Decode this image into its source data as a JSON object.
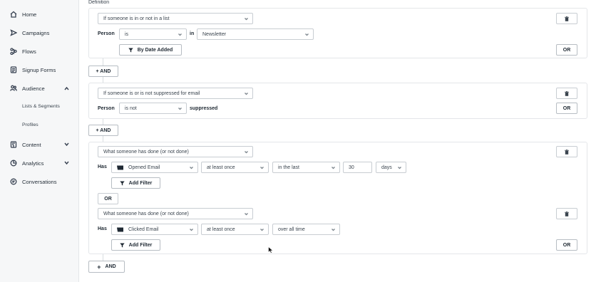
{
  "sidebar": {
    "items": [
      {
        "label": "Home",
        "icon": "home-icon"
      },
      {
        "label": "Campaigns",
        "icon": "send-icon"
      },
      {
        "label": "Flows",
        "icon": "flows-icon"
      },
      {
        "label": "Signup Forms",
        "icon": "form-icon"
      },
      {
        "label": "Audience",
        "icon": "audience-icon"
      },
      {
        "label": "Content",
        "icon": "content-icon"
      },
      {
        "label": "Analytics",
        "icon": "analytics-icon"
      },
      {
        "label": "Conversations",
        "icon": "chat-icon"
      }
    ],
    "audience_sub": [
      "Lists & Segments",
      "Profiles"
    ]
  },
  "main": {
    "definition_label": "Definition",
    "group1": {
      "condition": "If someone is in or not in a list",
      "person_label": "Person",
      "operator": "is",
      "in_label": "in",
      "list": "Newsletter",
      "filter_button": "By Date Added",
      "or_button": "OR"
    },
    "and_button_1": "+ AND",
    "group2": {
      "condition": "If someone is or is not suppressed for email",
      "person_label": "Person",
      "operator": "is not",
      "suppressed_text": "suppressed",
      "or_button": "OR"
    },
    "and_button_2": "+ AND",
    "group3": {
      "condition_a": "What someone has done (or not done)",
      "has_label_a": "Has",
      "metric_a": "Opened Email",
      "frequency_a": "at least once",
      "timeframe_a": "in the last",
      "number_a": "30",
      "unit_a": "days",
      "add_filter_a": "Add Filter",
      "or_separator": "OR",
      "condition_b": "What someone has done (or not done)",
      "has_label_b": "Has",
      "metric_b": "Clicked Email",
      "frequency_b": "at least once",
      "timeframe_b": "over all time",
      "add_filter_b": "Add Filter",
      "or_button": "OR"
    },
    "and_button_3": "AND"
  }
}
